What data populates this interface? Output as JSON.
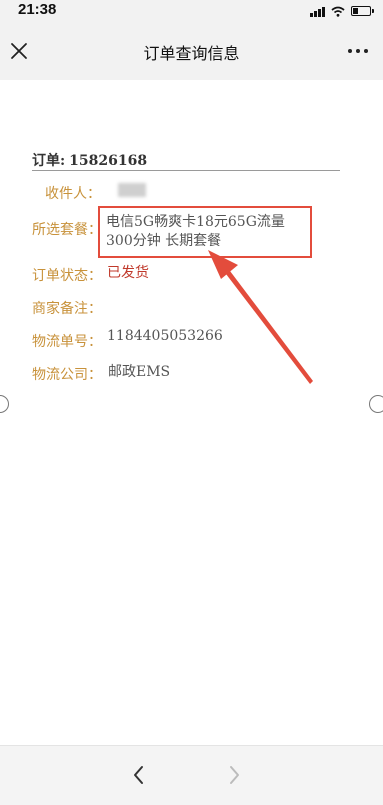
{
  "status_bar": {
    "time": "21:38",
    "battery_level": 0.3
  },
  "nav": {
    "title": "订单查询信息"
  },
  "order": {
    "label": "订单:",
    "number": "15826168",
    "fields": {
      "recipient_label": "收件人：",
      "package_label": "所选套餐：",
      "package_line1": "电信5G畅爽卡18元65G流量",
      "package_line2": "300分钟 长期套餐",
      "status_label": "订单状态：",
      "status_value": "已发货",
      "note_label": "商家备注：",
      "tracking_label": "物流单号：",
      "tracking_value": "1184405053266",
      "carrier_label": "物流公司：",
      "carrier_value": "邮政EMS"
    }
  },
  "icons": {
    "close": "close-icon",
    "more": "more-icon",
    "back": "chevron-left-icon",
    "forward": "chevron-right-icon"
  },
  "colors": {
    "label_gold": "#c8923b",
    "status_red": "#c0392b",
    "annotation_red": "#e34c3c"
  }
}
